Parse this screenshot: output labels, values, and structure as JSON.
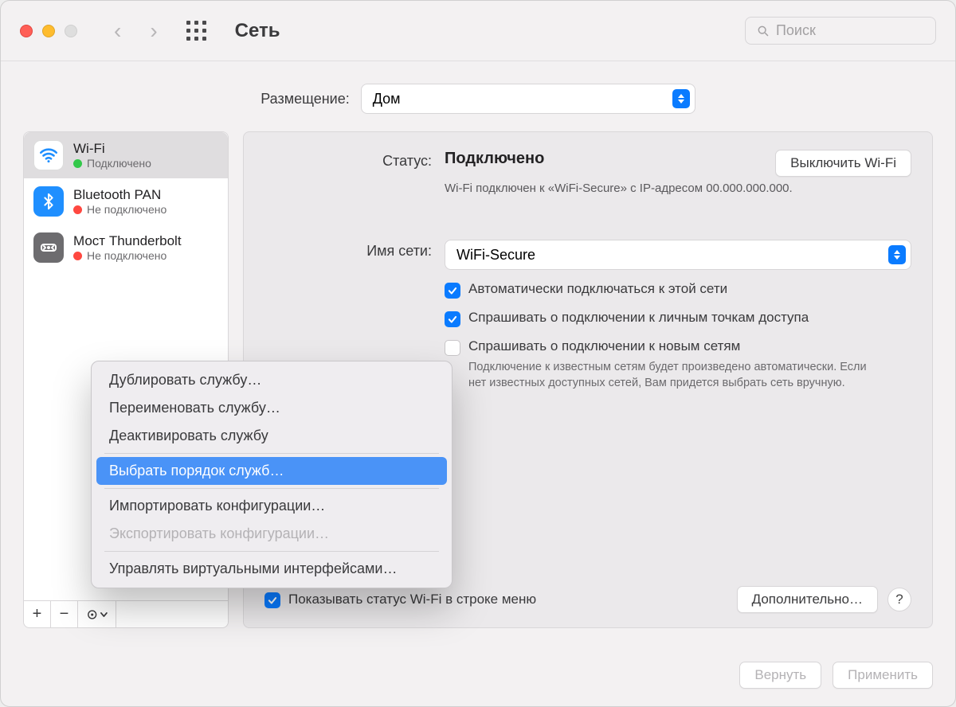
{
  "window": {
    "title": "Сеть"
  },
  "search": {
    "placeholder": "Поиск"
  },
  "location": {
    "label": "Размещение:",
    "value": "Дом"
  },
  "sidebar": {
    "items": [
      {
        "name": "Wi-Fi",
        "status": "Подключено",
        "dot": "green",
        "icon": "wifi",
        "selected": true
      },
      {
        "name": "Bluetooth PAN",
        "status": "Не подключено",
        "dot": "red",
        "icon": "bt",
        "selected": false
      },
      {
        "name": "Мост Thunderbolt",
        "status": "Не подключено",
        "dot": "red",
        "icon": "tb",
        "selected": false
      }
    ],
    "footer": {
      "add": "+",
      "remove": "−",
      "more": "⊙v"
    }
  },
  "panel": {
    "status_label": "Статус:",
    "status_value": "Подключено",
    "toggle_wifi": "Выключить Wi-Fi",
    "status_detail": "Wi-Fi подключен к «WiFi-Secure» с IP-адресом 00.000.000.000.",
    "network_label": "Имя сети:",
    "network_value": "WiFi-Secure",
    "cb_autojoin": "Автоматически подключаться к этой сети",
    "cb_ask_hotspot": "Спрашивать о подключении к личным точкам доступа",
    "cb_ask_new": "Спрашивать о подключении к новым сетям",
    "cb_ask_new_desc": "Подключение к известным сетям будет произведено автоматически. Если нет известных доступных сетей, Вам придется выбрать сеть вручную.",
    "cb_menubar": "Показывать статус Wi-Fi в строке меню",
    "advanced": "Дополнительно…"
  },
  "footer": {
    "revert": "Вернуть",
    "apply": "Применить"
  },
  "ctxmenu": {
    "items": [
      {
        "label": "Дублировать службу…",
        "state": "norm"
      },
      {
        "label": "Переименовать службу…",
        "state": "norm"
      },
      {
        "label": "Деактивировать службу",
        "state": "norm"
      },
      {
        "label": "---",
        "state": "sep"
      },
      {
        "label": "Выбрать порядок служб…",
        "state": "hl"
      },
      {
        "label": "---",
        "state": "sep"
      },
      {
        "label": "Импортировать конфигурации…",
        "state": "norm"
      },
      {
        "label": "Экспортировать конфигурации…",
        "state": "dis"
      },
      {
        "label": "---",
        "state": "sep"
      },
      {
        "label": "Управлять виртуальными интерфейсами…",
        "state": "norm"
      }
    ]
  }
}
